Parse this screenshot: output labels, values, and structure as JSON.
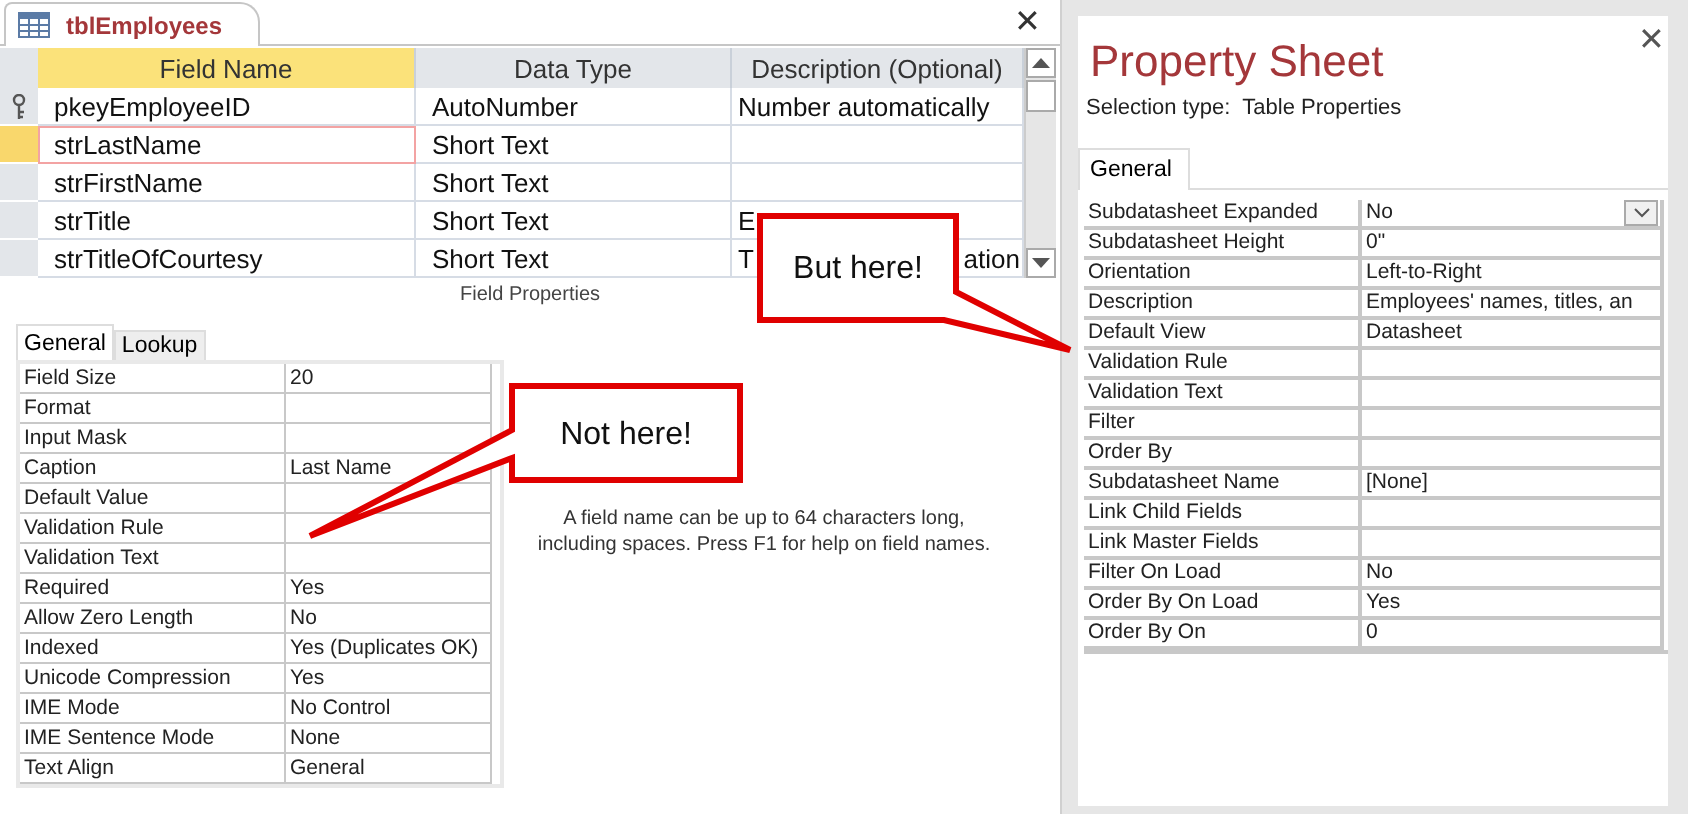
{
  "document_tab": {
    "title": "tblEmployees",
    "selected": true,
    "close_label": "✕"
  },
  "design_grid": {
    "columns": [
      {
        "label": "Field Name",
        "selected": true
      },
      {
        "label": "Data Type",
        "selected": false
      },
      {
        "label": "Description (Optional)",
        "selected": false
      }
    ],
    "rows": [
      {
        "field_name": "pkeyEmployeeID",
        "data_type": "AutoNumber",
        "description": "Number automatically",
        "primary_key": true,
        "selected": false
      },
      {
        "field_name": "strLastName",
        "data_type": "Short Text",
        "description": "",
        "primary_key": false,
        "selected": true
      },
      {
        "field_name": "strFirstName",
        "data_type": "Short Text",
        "description": "",
        "primary_key": false,
        "selected": false
      },
      {
        "field_name": "strTitle",
        "data_type": "Short Text",
        "description": "E",
        "primary_key": false,
        "selected": false
      },
      {
        "field_name": "strTitleOfCourtesy",
        "data_type": "Short Text",
        "description": "T",
        "description_tail": "ation",
        "primary_key": false,
        "selected": false
      }
    ]
  },
  "field_properties": {
    "heading": "Field Properties",
    "tabs": [
      {
        "label": "General",
        "selected": true
      },
      {
        "label": "Lookup",
        "selected": false
      }
    ],
    "rows": [
      {
        "name": "Field Size",
        "value": "20"
      },
      {
        "name": "Format",
        "value": ""
      },
      {
        "name": "Input Mask",
        "value": ""
      },
      {
        "name": "Caption",
        "value": "Last Name"
      },
      {
        "name": "Default Value",
        "value": ""
      },
      {
        "name": "Validation Rule",
        "value": ""
      },
      {
        "name": "Validation Text",
        "value": ""
      },
      {
        "name": "Required",
        "value": "Yes"
      },
      {
        "name": "Allow Zero Length",
        "value": "No"
      },
      {
        "name": "Indexed",
        "value": "Yes (Duplicates OK)"
      },
      {
        "name": "Unicode Compression",
        "value": "Yes"
      },
      {
        "name": "IME Mode",
        "value": "No Control"
      },
      {
        "name": "IME Sentence Mode",
        "value": "None"
      },
      {
        "name": "Text Align",
        "value": "General"
      }
    ],
    "help_text": "A field name can be up to 64 characters long, including spaces. Press F1 for help on field names."
  },
  "property_sheet": {
    "title": "Property Sheet",
    "close_label": "✕",
    "selection_label": "Selection type:",
    "selection_type": "Table Properties",
    "tabs": [
      {
        "label": "General",
        "selected": true
      }
    ],
    "rows": [
      {
        "name": "Subdatasheet Expanded",
        "value": "No",
        "kind": "dropdown"
      },
      {
        "name": "Subdatasheet Height",
        "value": "0\"",
        "kind": "text"
      },
      {
        "name": "Orientation",
        "value": "Left-to-Right",
        "kind": "text"
      },
      {
        "name": "Description",
        "value": "Employees' names, titles, an",
        "kind": "text"
      },
      {
        "name": "Default View",
        "value": "Datasheet",
        "kind": "text"
      },
      {
        "name": "Validation Rule",
        "value": "",
        "kind": "text"
      },
      {
        "name": "Validation Text",
        "value": "",
        "kind": "text"
      },
      {
        "name": "Filter",
        "value": "",
        "kind": "text"
      },
      {
        "name": "Order By",
        "value": "",
        "kind": "text"
      },
      {
        "name": "Subdatasheet Name",
        "value": "[None]",
        "kind": "text"
      },
      {
        "name": "Link Child Fields",
        "value": "",
        "kind": "text"
      },
      {
        "name": "Link Master Fields",
        "value": "",
        "kind": "text"
      },
      {
        "name": "Filter On Load",
        "value": "No",
        "kind": "text"
      },
      {
        "name": "Order By On Load",
        "value": "Yes",
        "kind": "text"
      },
      {
        "name": "Order By On",
        "value": "0",
        "kind": "text"
      }
    ]
  },
  "callouts": [
    {
      "text": "But here!",
      "kind": "pointer_right"
    },
    {
      "text": "Not here!",
      "kind": "pointer_left"
    }
  ]
}
